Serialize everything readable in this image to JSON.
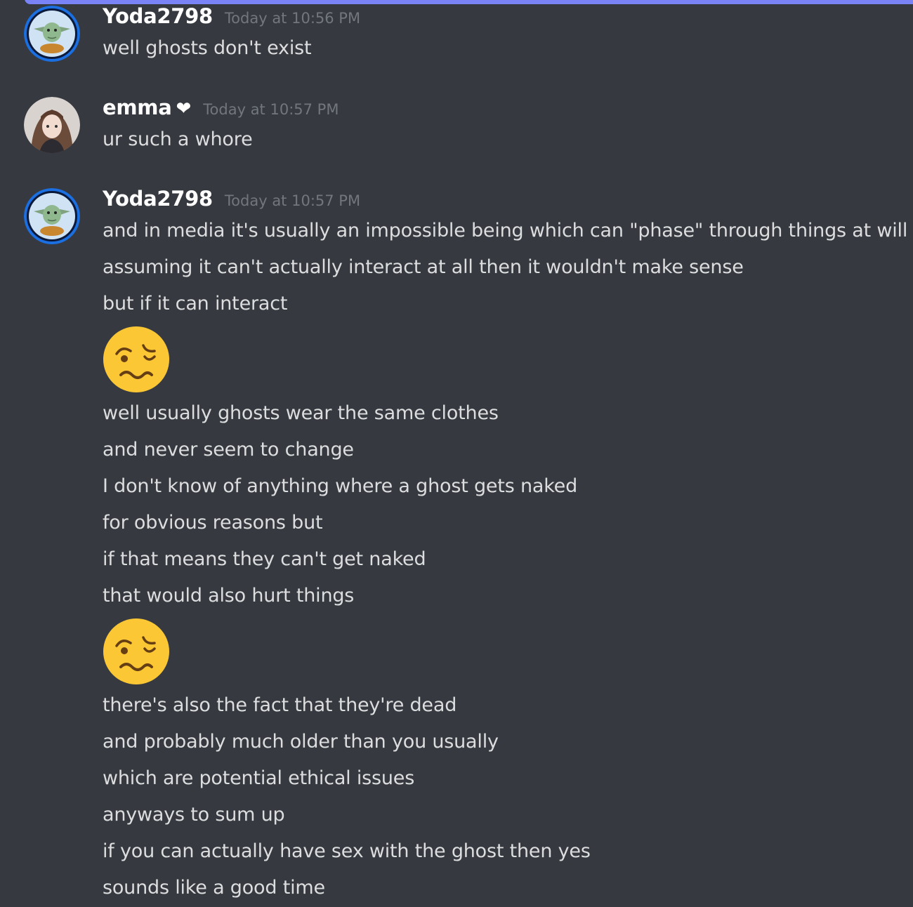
{
  "messages": [
    {
      "username": "Yoda2798",
      "timestamp": "Today at 10:56 PM",
      "avatar_icon": "yoda-avatar-icon",
      "lines": [
        "well ghosts don't exist"
      ]
    },
    {
      "username": "emma",
      "badge_icon": "heart-icon",
      "badge_glyph": "❤",
      "timestamp": "Today at 10:57 PM",
      "avatar_icon": "anime-girl-avatar-icon",
      "lines": [
        "ur such a whore"
      ]
    },
    {
      "username": "Yoda2798",
      "timestamp": "Today at 10:57 PM",
      "avatar_icon": "yoda-avatar-icon",
      "lines": [
        "and in media it's usually an impossible being which can \"phase\" through things at will",
        "assuming it can't actually interact at all then it wouldn't make sense",
        "but if it can interact",
        "well usually ghosts wear the same clothes",
        "and never seem to change",
        "I don't know of anything where a ghost gets naked",
        "for obvious reasons but",
        "if that means they can't get naked",
        "that would also hurt things",
        "there's also the fact that they're dead",
        "and probably much older than you usually",
        "which are potential ethical issues",
        "anyways to sum up",
        "if you can actually have sex with the ghost then yes",
        "sounds like a good time"
      ],
      "emojis": [
        "woozy-face-icon",
        "woozy-face-icon"
      ]
    }
  ],
  "colors": {
    "background": "#36393f",
    "username": "#ffffff",
    "timestamp": "#72767d",
    "message_text": "#dcddde",
    "top_bar": "#7983f5",
    "avatar_ring": "#1b6fe0"
  }
}
